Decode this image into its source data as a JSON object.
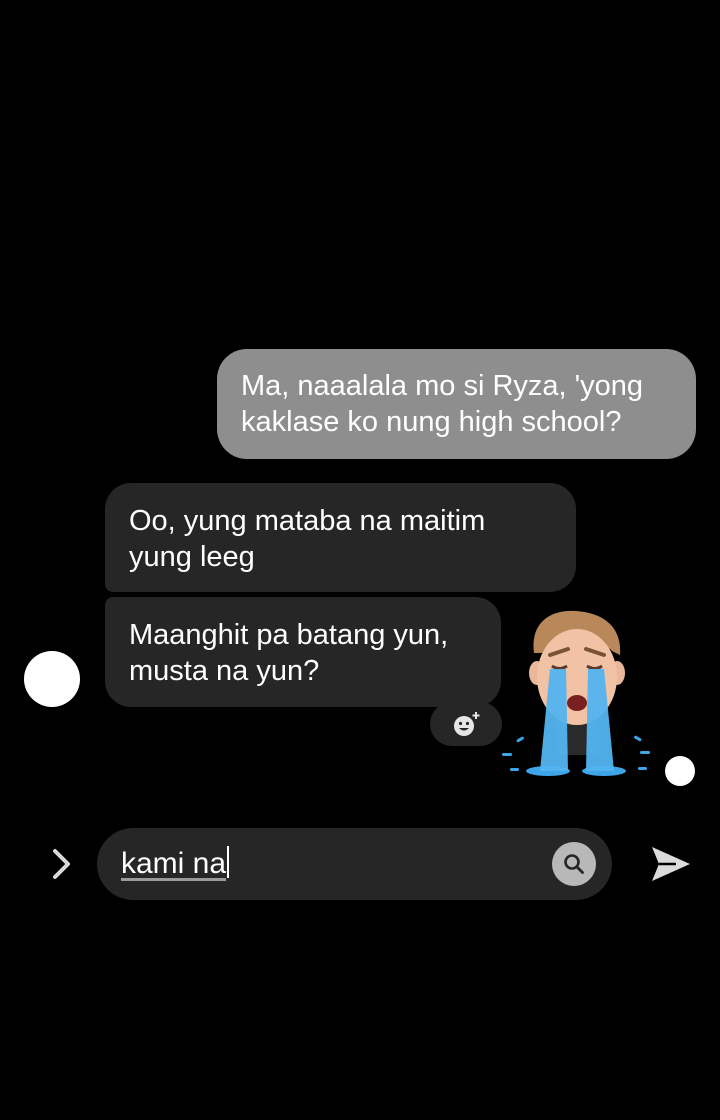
{
  "messages": [
    {
      "direction": "sent",
      "text": "Ma, naaalala mo si Ryza, 'yong\nkaklase ko nung high school?"
    },
    {
      "direction": "received",
      "text": "Oo, yung mataba na maitim\nyung leeg"
    },
    {
      "direction": "received",
      "text": "Maanghit pa batang yun,\nmusta na yun?"
    }
  ],
  "sticker": {
    "icon": "crying-memoji-sticker"
  },
  "composer": {
    "input_value": "kami na",
    "expand_icon": "chevron-right-icon",
    "search_icon": "search-icon",
    "send_icon": "send-icon"
  },
  "colors": {
    "background": "#000000",
    "sent_bubble": "#8e8e8e",
    "received_bubble": "#262626",
    "input_background": "#262626"
  }
}
